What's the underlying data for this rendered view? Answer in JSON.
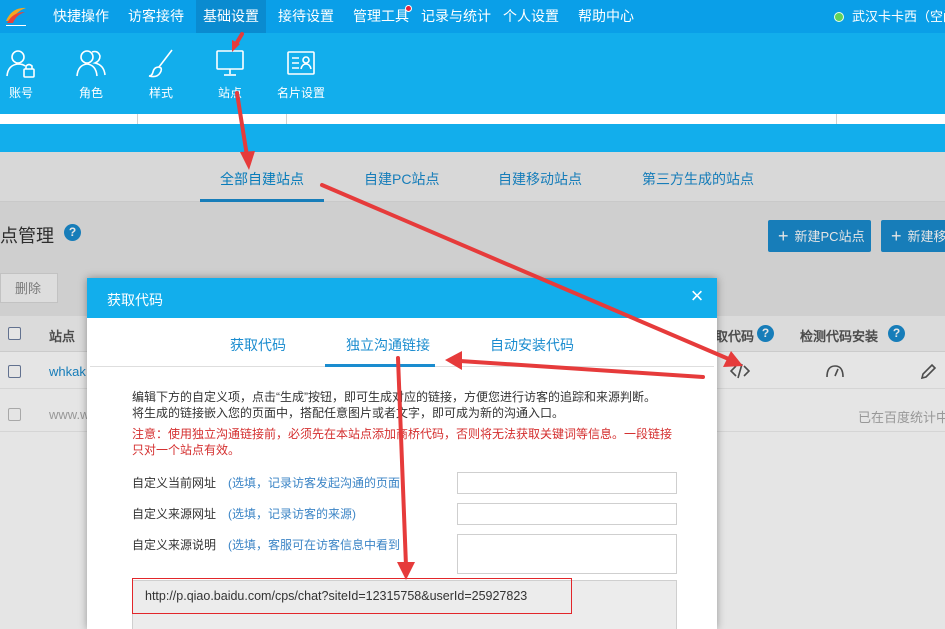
{
  "topnav": {
    "items": [
      "快捷操作",
      "访客接待",
      "基础设置",
      "接待设置",
      "管理工具",
      "记录与统计",
      "个人设置",
      "帮助中心"
    ],
    "user": "武汉卡卡西（空闲"
  },
  "toolbar": {
    "items": [
      "账号",
      "角色",
      "样式",
      "站点",
      "名片设置"
    ]
  },
  "subtabs": [
    "全部自建站点",
    "自建PC站点",
    "自建移动站点",
    "第三方生成的站点"
  ],
  "page": {
    "title": "点管理",
    "help": "?",
    "new_pc": "新建PC站点",
    "new_mobile": "新建移",
    "delete": "删除"
  },
  "table": {
    "headers": {
      "site": "站点",
      "code": "取代码",
      "detect": "检测代码安装"
    },
    "rows": [
      {
        "site": "whkak"
      },
      {
        "site": "www.w",
        "status": "已在百度统计中"
      }
    ]
  },
  "modal": {
    "title": "获取代码",
    "close": "×",
    "tabs": [
      "获取代码",
      "独立沟通链接",
      "自动安装代码"
    ],
    "desc1": "编辑下方的自定义项，点击“生成”按钮，即可生成对应的链接，方便您进行访客的追踪和来源判断。",
    "desc2": "将生成的链接嵌入您的页面中，搭配任意图片或者文字，即可成为新的沟通入口。",
    "warning": "注意：使用独立沟通链接前，必须先在本站点添加商桥代码，否则将无法获取关键词等信息。一段链接只对一个站点有效。",
    "fields": [
      {
        "label": "自定义当前网址",
        "hint": "(选填，记录访客发起沟通的页面"
      },
      {
        "label": "自定义来源网址",
        "hint": "(选填，记录访客的来源)"
      },
      {
        "label": "自定义来源说明",
        "hint": "(选填，客服可在访客信息中看到"
      }
    ],
    "link": "http://p.qiao.baidu.com/cps/chat?siteId=12315758&userId=25927823"
  },
  "colors": {
    "nav_blue": "#0a9fe8",
    "toolbar_blue": "#12aeec",
    "link_blue": "#1a8ccf",
    "warning_red": "#d42e2e",
    "annotation_red": "#e63b3b"
  }
}
